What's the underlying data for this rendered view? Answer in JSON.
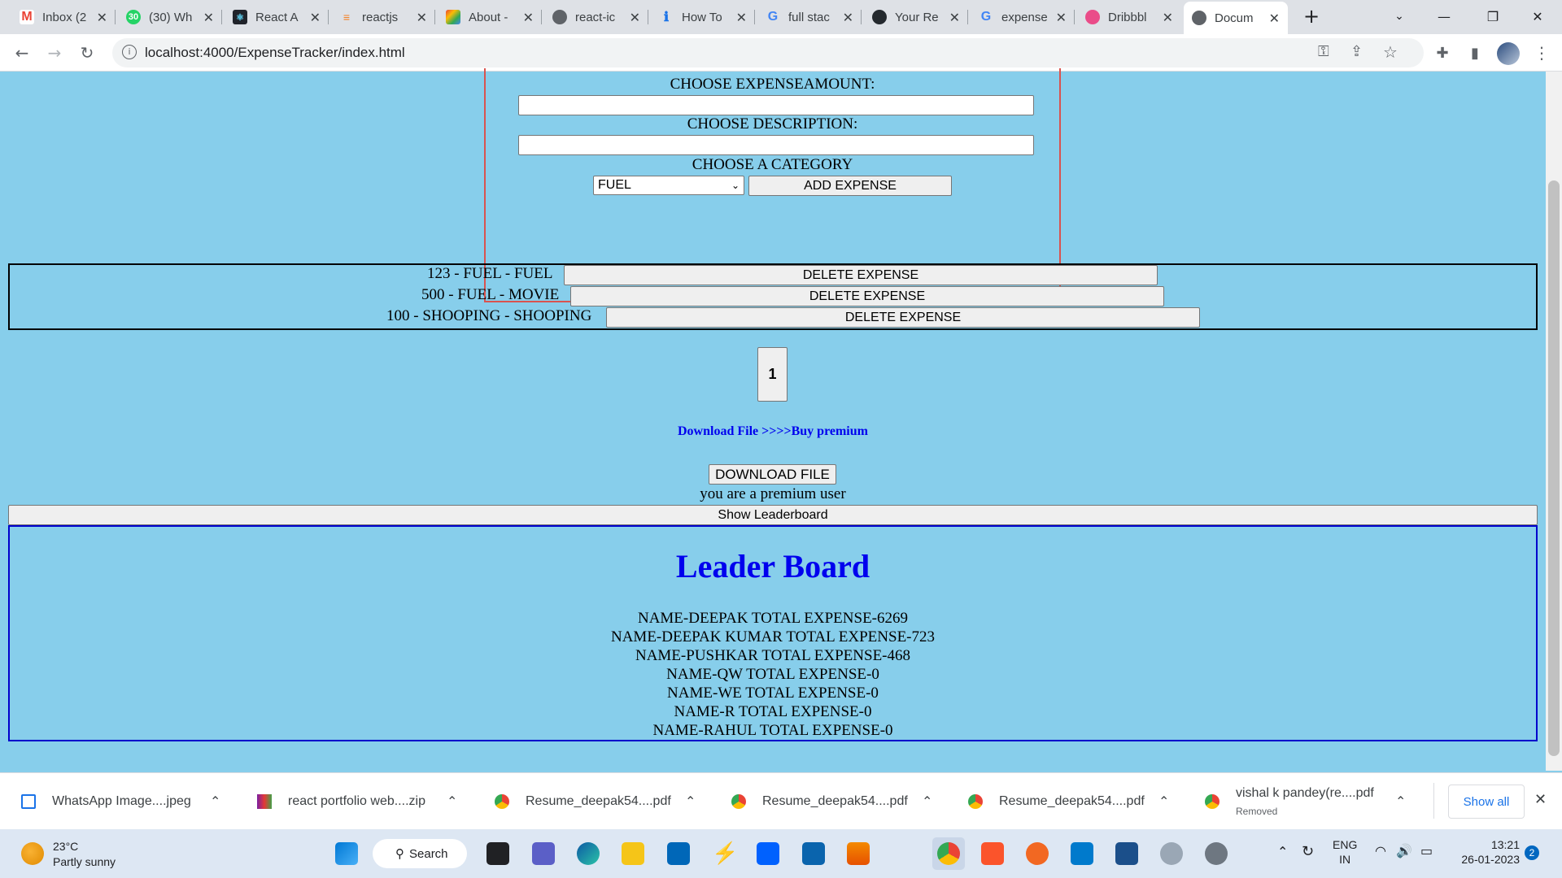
{
  "browser": {
    "tabs": [
      {
        "title": "Inbox (2",
        "icon": "gmail-icon",
        "color": "#ea4335"
      },
      {
        "title": "(30) Wh",
        "icon": "whatsapp-icon",
        "color": "#25d366"
      },
      {
        "title": "React A",
        "icon": "react-icon",
        "color": "#20232a"
      },
      {
        "title": "reactjs",
        "icon": "stackoverflow-icon",
        "color": "#f48024"
      },
      {
        "title": "About -",
        "icon": "app-icon",
        "color": "#1a73e8"
      },
      {
        "title": "react-ic",
        "icon": "globe-icon",
        "color": "#5f6368"
      },
      {
        "title": "How To",
        "icon": "info-icon",
        "color": "#1a73e8"
      },
      {
        "title": "full stac",
        "icon": "google-icon",
        "color": "#4285f4"
      },
      {
        "title": "Your Re",
        "icon": "github-icon",
        "color": "#24292e"
      },
      {
        "title": "expense",
        "icon": "google-icon",
        "color": "#4285f4"
      },
      {
        "title": "Dribbbl",
        "icon": "dribbble-icon",
        "color": "#ea4c89"
      },
      {
        "title": "Docum",
        "icon": "globe-icon",
        "color": "#5f6368"
      }
    ],
    "url": "localhost:4000/ExpenseTracker/index.html"
  },
  "form": {
    "amount_label": "CHOOSE EXPENSEAMOUNT:",
    "description_label": "CHOOSE DESCRIPTION:",
    "category_label": "CHOOSE A CATEGORY",
    "category_selected": "FUEL",
    "add_button": "ADD EXPENSE"
  },
  "expenses": [
    {
      "text": "123 - FUEL - FUEL",
      "button": "DELETE EXPENSE"
    },
    {
      "text": "500 - FUEL - MOVIE",
      "button": "DELETE EXPENSE"
    },
    {
      "text": "100 - SHOOPING - SHOOPING",
      "button": "DELETE EXPENSE"
    }
  ],
  "pagination": {
    "page": "1"
  },
  "premium": {
    "download_link": "Download File",
    "buy_link": ">>>>Buy premium",
    "download_button": "DOWNLOAD FILE",
    "status": "you are a premium user",
    "leaderboard_button": "Show Leaderboard"
  },
  "leaderboard": {
    "title": "Leader Board",
    "entries": [
      "NAME-DEEPAK TOTAL EXPENSE-6269",
      "NAME-DEEPAK KUMAR TOTAL EXPENSE-723",
      "NAME-PUSHKAR TOTAL EXPENSE-468",
      "NAME-QW TOTAL EXPENSE-0",
      "NAME-WE TOTAL EXPENSE-0",
      "NAME-R TOTAL EXPENSE-0",
      "NAME-RAHUL TOTAL EXPENSE-0"
    ]
  },
  "downloads": [
    {
      "name": "WhatsApp Image....jpeg",
      "sub": ""
    },
    {
      "name": "react portfolio web....zip",
      "sub": ""
    },
    {
      "name": "Resume_deepak54....pdf",
      "sub": ""
    },
    {
      "name": "Resume_deepak54....pdf",
      "sub": ""
    },
    {
      "name": "Resume_deepak54....pdf",
      "sub": ""
    },
    {
      "name": "vishal k pandey(re....pdf",
      "sub": "Removed"
    }
  ],
  "downloads_show_all": "Show all",
  "taskbar": {
    "weather_temp": "23°C",
    "weather_desc": "Partly sunny",
    "search": "Search",
    "lang": "ENG",
    "region": "IN",
    "time": "13:21",
    "date": "26-01-2023",
    "notifications": "2"
  }
}
